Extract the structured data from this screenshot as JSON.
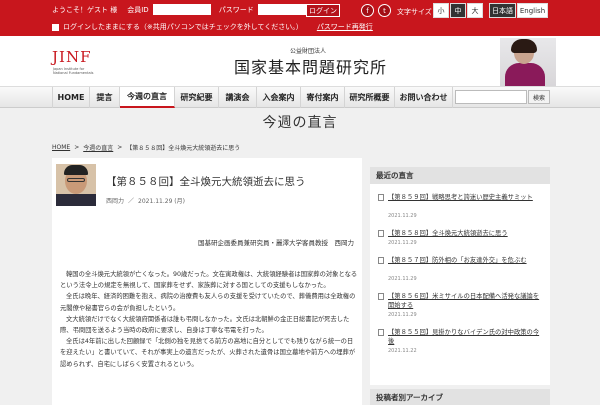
{
  "topbar": {
    "welcome": "ようこそ！ゲスト 様",
    "member_id_label": "会員ID",
    "password_label": "パスワード",
    "login_button": "ログイン",
    "remember_label": "ログインしたままにする（※共用パソコンではチェックを外してください。）",
    "password_reset": "パスワード再発行",
    "font_size_label": "文字サイズ",
    "font_sizes": [
      "小",
      "中",
      "大"
    ],
    "font_size_selected": "中",
    "languages": [
      "日本語",
      "English"
    ],
    "language_selected": "日本語",
    "social": [
      {
        "name": "facebook-icon",
        "glyph": "f"
      },
      {
        "name": "twitter-icon",
        "glyph": "t"
      }
    ],
    "brand_color": "#c8161d"
  },
  "header": {
    "logo": "JINF",
    "logo_sub": "Japan Institute for National Fundamentals",
    "org_small": "公益財団法人",
    "org_name": "国家基本問題研究所"
  },
  "nav": {
    "items": [
      {
        "label": "HOME",
        "active": false
      },
      {
        "label": "提言",
        "active": false
      },
      {
        "label": "今週の直言",
        "active": true
      },
      {
        "label": "研究紀要",
        "active": false
      },
      {
        "label": "講演会",
        "active": false
      },
      {
        "label": "入会案内",
        "active": false
      },
      {
        "label": "寄付案内",
        "active": false
      },
      {
        "label": "研究所概要",
        "active": false
      },
      {
        "label": "お問い合わせ",
        "active": false
      }
    ],
    "search_button": "検索"
  },
  "page": {
    "title": "今週の直言",
    "breadcrumb": [
      "HOME",
      "今週の直言",
      "【第８５８回】全斗煥元大統領逝去に思う"
    ]
  },
  "article": {
    "title": "【第８５８回】全斗煥元大統領逝去に思う",
    "author_short": "西岡力",
    "date": "2021.11.29 (月)",
    "author_full": "国基研企画委員兼研究員・麗澤大学客員教授　西岡力",
    "paragraphs": [
      "韓国の全斗煥元大統領が亡くなった。90歳だった。文在寅政権は、大統領経験者は国家葬の対象となるという法令上の規定を無視して、国家葬をせず、家族葬に対する国としての支援もしなかった。",
      "全氏は晩年、経済的困難を抱え、病院の治療費も友人らの支援を受けていたので、葬儀費用は全政権の元閣僚や秘書官らの会が負担したという。",
      "文大統領だけでなく大統領府関係者は誰も弔問しなかった。文氏は北朝鮮の金正日総書記が死去した際、弔問団を送るよう当時の政府に要求し、自身は丁寧な弔電を打った。",
      "全氏は4年前に出した回顧録で「北側の独を見捨てる前方の高地に自分としてでも残りながら統一の日を迎えたい」と書いていて、それが事実上の遺言だったが、火葬された遺骨は国立墓地や前方への埋葬が認められず、自宅にしばらく安置されるという。"
    ]
  },
  "sidebar": {
    "recent_title": "最近の直言",
    "recent": [
      {
        "title": "【第８５９回】戦略思考と誇迷い歴史主義サミット",
        "date": "2021.11.29"
      },
      {
        "title": "【第８５８回】全斗煥元大統領逝去に思う",
        "date": "2021.11.29"
      },
      {
        "title": "【第８５７回】防外相の「お友達外交」を危ぶむ",
        "date": "2021.11.29"
      },
      {
        "title": "【第８５６回】米ミサイルの日本配備へ活発な議論を開始する",
        "date": "2021.11.29"
      },
      {
        "title": "【第８５５回】見掛かりなバイデン氏の対中政策の今後",
        "date": "2021.11.22"
      }
    ],
    "archive_title": "投稿者別アーカイブ"
  }
}
